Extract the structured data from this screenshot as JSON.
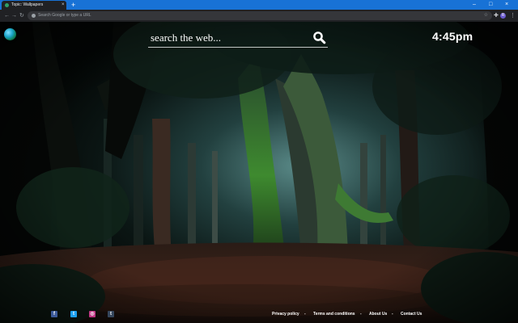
{
  "browser": {
    "tab_title": "Topic: Wallpapers",
    "tab_close": "×",
    "new_tab": "+",
    "omnibox_placeholder": "Search Google or type a URL",
    "profile_initial": "R",
    "accent": "#1872d6",
    "window_controls": [
      "–",
      "□",
      "×"
    ]
  },
  "page": {
    "search": {
      "placeholder": "search the web..."
    },
    "clock": "4:45pm",
    "social": [
      {
        "name": "facebook",
        "glyph": "f",
        "color": "#3b5998"
      },
      {
        "name": "twitter",
        "glyph": "t",
        "color": "#1da1f2"
      },
      {
        "name": "instagram",
        "glyph": "◎",
        "color": "#c13584"
      },
      {
        "name": "tumblr",
        "glyph": "t",
        "color": "#35465c"
      }
    ],
    "footer_links": [
      "Privacy policy",
      "Terms and conditions",
      "About Us",
      "Contact Us"
    ],
    "footer_separator": "-"
  }
}
